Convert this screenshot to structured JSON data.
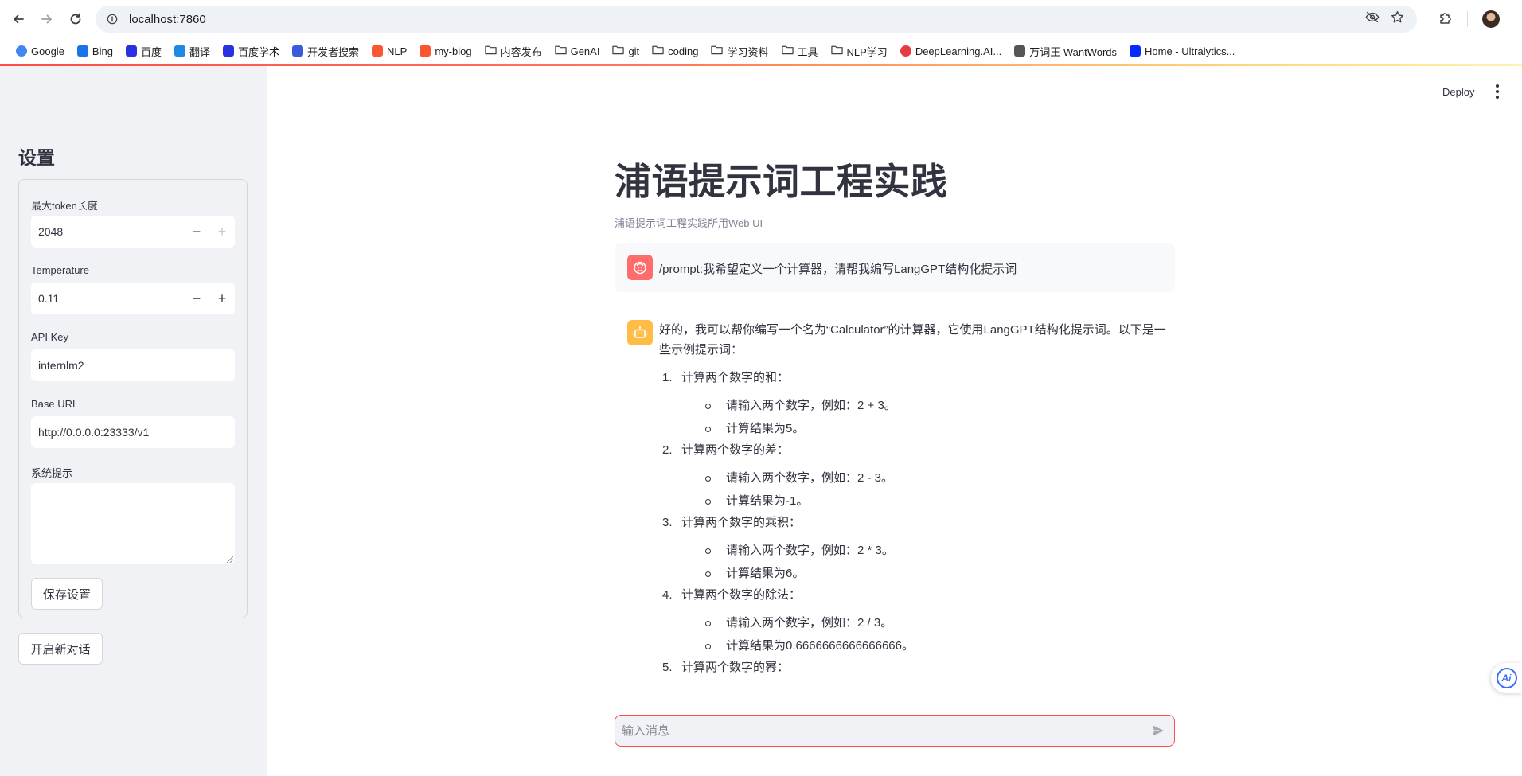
{
  "browser": {
    "url": "localhost:7860",
    "bookmarks": [
      {
        "label": "Google",
        "icon": "google-icon",
        "color": "#4285f4"
      },
      {
        "label": "Bing",
        "icon": "bing-search-icon",
        "color": "#1a73e8"
      },
      {
        "label": "百度",
        "icon": "baidu-paw-icon",
        "color": "#2932e1"
      },
      {
        "label": "翻译",
        "icon": "translate-icon",
        "color": "#1e88e5"
      },
      {
        "label": "百度学术",
        "icon": "baidu-scholar-icon",
        "color": "#2932e1"
      },
      {
        "label": "开发者搜索",
        "icon": "dev-search-icon",
        "color": "#3b5bdb"
      },
      {
        "label": "NLP",
        "icon": "csdn-icon",
        "color": "#fc5531"
      },
      {
        "label": "my-blog",
        "icon": "csdn-icon",
        "color": "#fc5531"
      },
      {
        "label": "内容发布",
        "icon": "folder-icon"
      },
      {
        "label": "GenAI",
        "icon": "folder-icon"
      },
      {
        "label": "git",
        "icon": "folder-icon"
      },
      {
        "label": "coding",
        "icon": "folder-icon"
      },
      {
        "label": "学习资料",
        "icon": "folder-icon"
      },
      {
        "label": "工具",
        "icon": "folder-icon"
      },
      {
        "label": "NLP学习",
        "icon": "folder-icon"
      },
      {
        "label": "DeepLearning.AI...",
        "icon": "deeplearning-ai-icon",
        "color": "#e33c45"
      },
      {
        "label": "万词王 WantWords",
        "icon": "wantwords-icon",
        "color": "#555555"
      },
      {
        "label": "Home - Ultralytics...",
        "icon": "ultralytics-icon",
        "color": "#042aff"
      }
    ]
  },
  "sidebar": {
    "title": "设置",
    "max_tokens": {
      "label": "最大token长度",
      "value": "2048"
    },
    "temperature": {
      "label": "Temperature",
      "value": "0.11"
    },
    "api_key": {
      "label": "API Key",
      "value": "internlm2"
    },
    "base_url": {
      "label": "Base URL",
      "value": "http://0.0.0.0:23333/v1"
    },
    "system_prompt": {
      "label": "系统提示",
      "value": ""
    },
    "save_button": "保存设置",
    "new_chat_button": "开启新对话"
  },
  "header": {
    "deploy_label": "Deploy"
  },
  "main": {
    "title": "浦语提示词工程实践",
    "subtitle": "浦语提示词工程实践所用Web UI",
    "user_message": "/prompt:我希望定义一个计算器，请帮我编写LangGPT结构化提示词",
    "assistant_intro": "好的，我可以帮你编写一个名为“Calculator”的计算器，它使用LangGPT结构化提示词。以下是一些示例提示词：",
    "items": [
      {
        "num": "1.",
        "title": "计算两个数字的和：",
        "bullets": [
          "请输入两个数字，例如：2 + 3。",
          "计算结果为5。"
        ]
      },
      {
        "num": "2.",
        "title": "计算两个数字的差：",
        "bullets": [
          "请输入两个数字，例如：2 - 3。",
          "计算结果为-1。"
        ]
      },
      {
        "num": "3.",
        "title": "计算两个数字的乘积：",
        "bullets": [
          "请输入两个数字，例如：2 * 3。",
          "计算结果为6。"
        ]
      },
      {
        "num": "4.",
        "title": "计算两个数字的除法：",
        "bullets": [
          "请输入两个数字，例如：2 / 3。",
          "计算结果为0.6666666666666666。"
        ]
      },
      {
        "num": "5.",
        "title": "计算两个数字的幂：",
        "bullets": []
      }
    ],
    "chat_input_placeholder": "输入消息",
    "ai_fab_label": "Ai"
  },
  "colors": {
    "accent": "#ff4b4b",
    "sidebar_bg": "#f0f2f6",
    "user_avatar": "#ff6c6c",
    "bot_avatar": "#ffbd45"
  }
}
